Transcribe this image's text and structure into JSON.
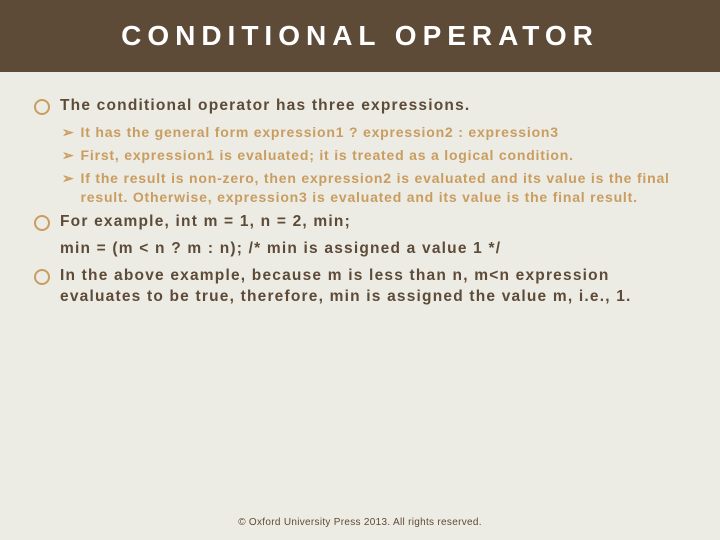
{
  "title": "CONDITIONAL OPERATOR",
  "bullets": {
    "main0": "The conditional operator has three expressions.",
    "sub0": " It has the general form expression1 ? expression2 : expression3",
    "sub1": "First, expression1 is evaluated; it is treated as a logical condition.",
    "sub2": "If the result is non-zero, then expression2 is evaluated and its value is the final result. Otherwise, expression3 is evaluated and its value is the final result.",
    "main1": "For example, int m = 1, n = 2, min;",
    "cont1": "min = (m < n ? m : n); /* min is assigned a value 1 */",
    "main2": "In the above example, because m is less than n, m<n expression evaluates to be true, therefore, min is assigned the value m, i.e., 1."
  },
  "footer": "© Oxford University Press 2013. All rights reserved."
}
